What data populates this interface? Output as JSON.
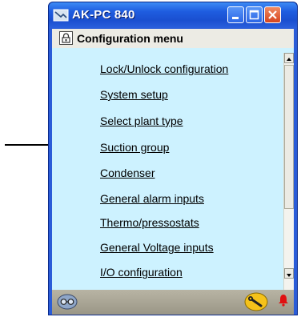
{
  "window": {
    "title": "AK-PC 840"
  },
  "menu": {
    "title": "Configuration menu",
    "items": [
      {
        "label": "Lock/Unlock configuration"
      },
      {
        "label": "System setup"
      },
      {
        "label": "Select plant type"
      },
      {
        "label": "Suction group"
      },
      {
        "label": "Condenser"
      },
      {
        "label": "General alarm inputs"
      },
      {
        "label": "Thermo/pressostats"
      },
      {
        "label": "General Voltage inputs"
      },
      {
        "label": "I/O configuration"
      }
    ]
  },
  "colors": {
    "titlebar": "#1f5de0",
    "content_background": "#cdf2ff",
    "close_button": "#d6441e",
    "bell": "#e01010"
  },
  "icons": {
    "app": "monitor-icon",
    "lock": "lock-icon",
    "status_left": "glasses-icon",
    "status_middle": "wrench-icon",
    "status_right": "bell-icon"
  }
}
